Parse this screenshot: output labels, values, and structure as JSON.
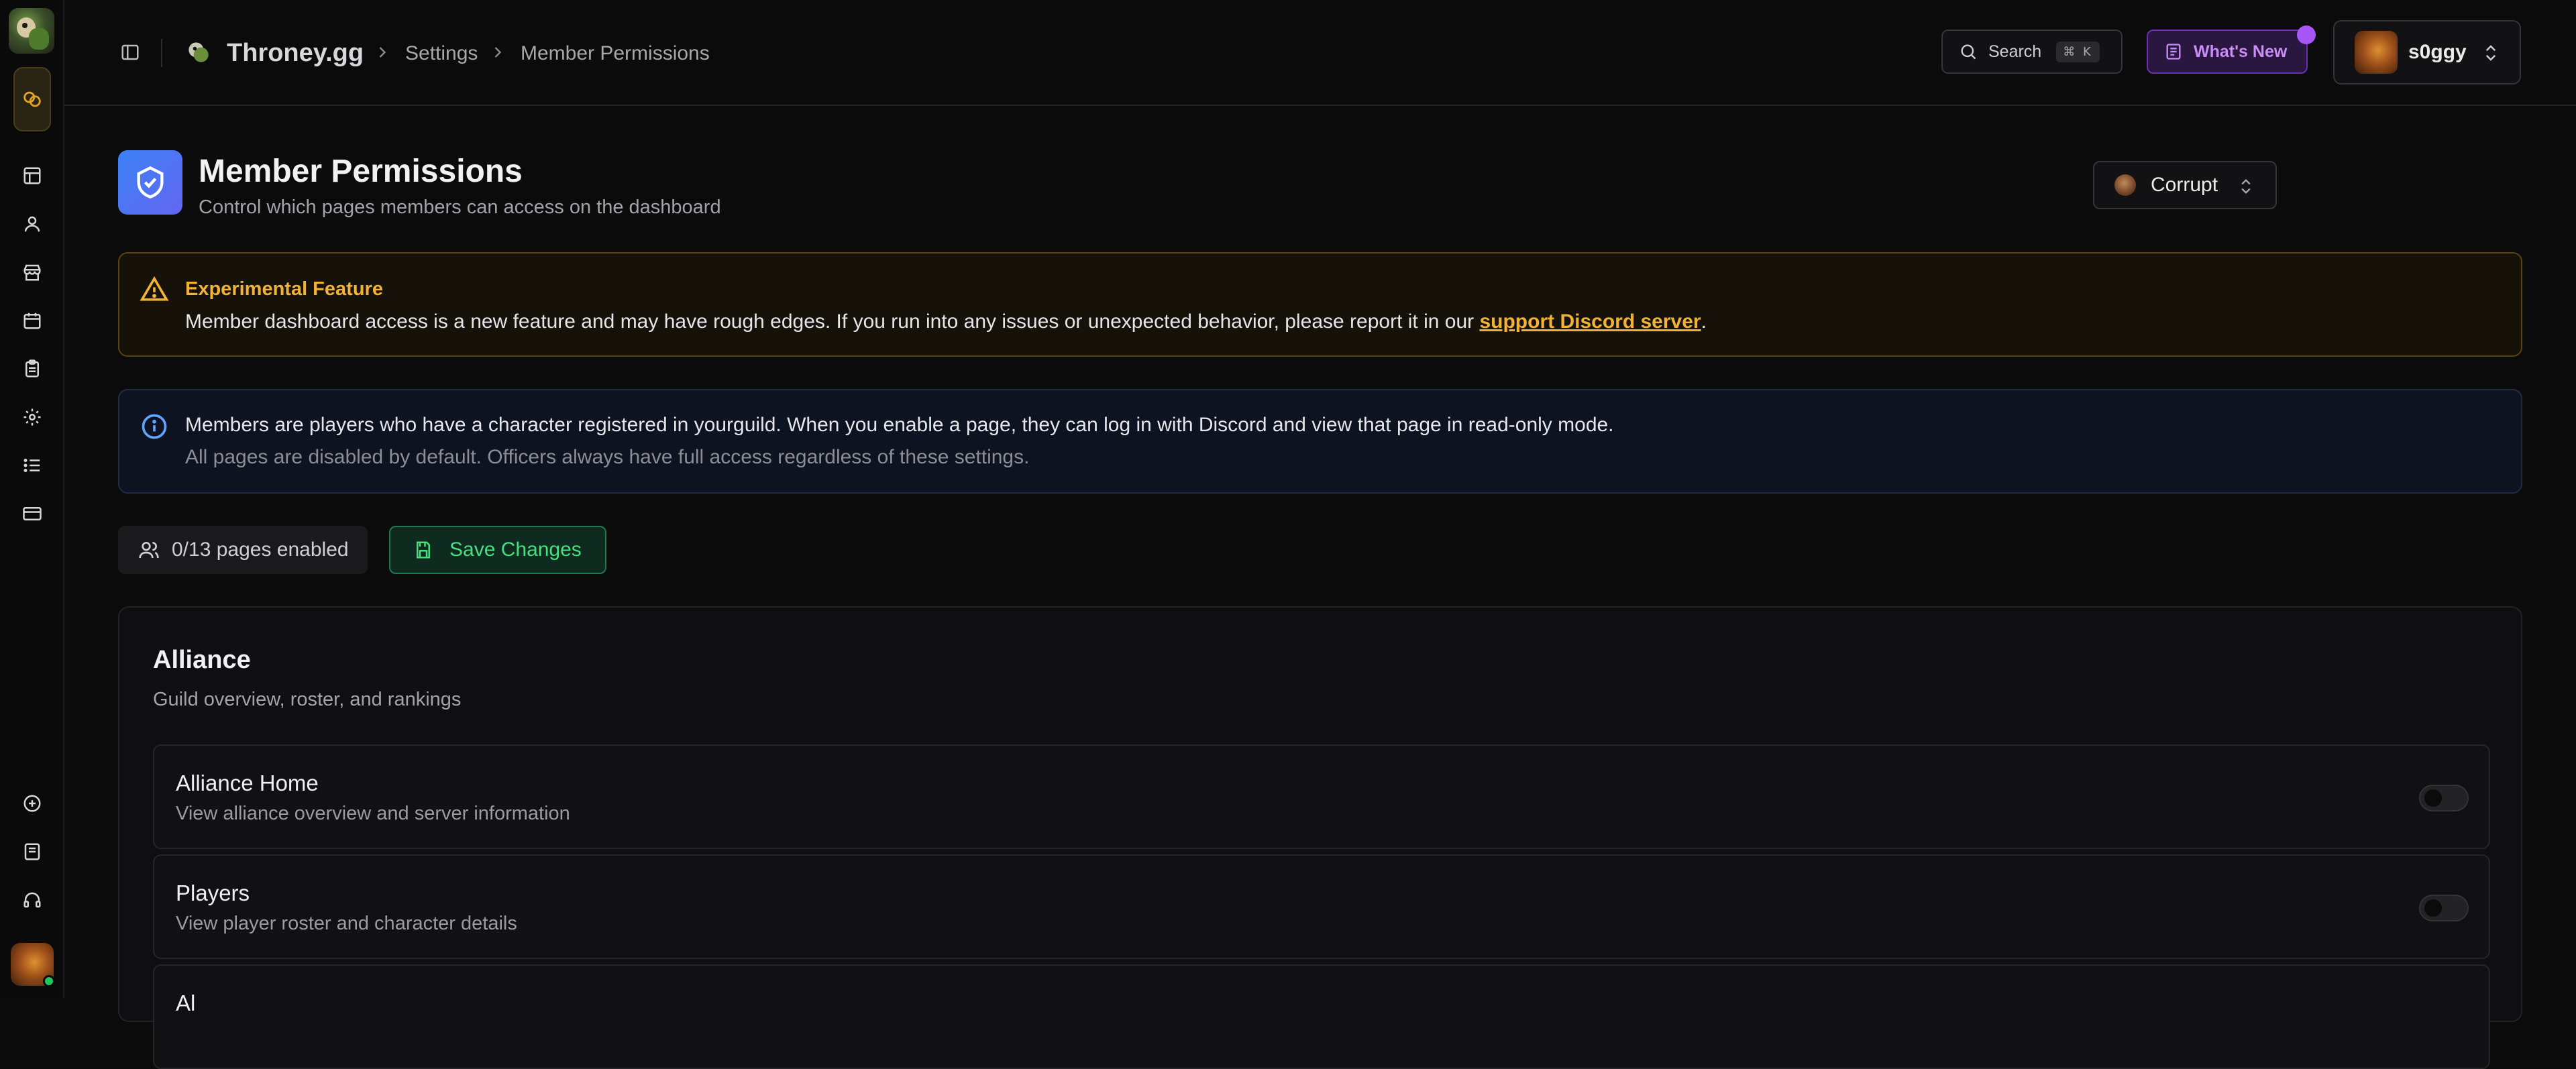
{
  "rail": {
    "logo_icon": "throney-mascot-logo",
    "guild_icon": "guild-rings-icon",
    "nav_icons": [
      "layout-icon",
      "user-icon",
      "store-icon",
      "calendar-icon",
      "clipboard-icon",
      "gear-icon",
      "list-icon",
      "card-icon"
    ],
    "bottom_icons": [
      "plus-circle-icon",
      "book-icon",
      "headset-icon"
    ],
    "status_color": "#22c55e"
  },
  "header": {
    "brand": "Throney.gg",
    "breadcrumb": [
      "Settings",
      "Member Permissions"
    ],
    "search_label": "Search",
    "search_shortcut": "⌘ K",
    "whats_new_label": "What's New",
    "username": "s0ggy"
  },
  "page": {
    "title": "Member Permissions",
    "subtitle": "Control which pages members can access on the dashboard",
    "guild_selector": "Corrupt"
  },
  "warning": {
    "title": "Experimental Feature",
    "body_prefix": "Member dashboard access is a new feature and may have rough edges. If you run into any issues or unexpected behavior, please report it in our ",
    "link": "support Discord server",
    "body_suffix": "."
  },
  "info": {
    "line1": "Members are players who have a character registered in yourguild. When you enable a page, they can log in with Discord and view that page in read-only mode.",
    "line2": "All pages are disabled by default. Officers always have full access regardless of these settings."
  },
  "toolbar": {
    "pages_enabled": "0/13 pages enabled",
    "save_label": "Save Changes"
  },
  "section": {
    "title": "Alliance",
    "subtitle": "Guild overview, roster, and rankings",
    "items": [
      {
        "title": "Alliance Home",
        "description": "View alliance overview and server information",
        "enabled": false
      },
      {
        "title": "Players",
        "description": "View player roster and character details",
        "enabled": false
      },
      {
        "title": "Al",
        "description": "",
        "enabled": false
      }
    ]
  },
  "colors": {
    "accent_warning": "#f2b233",
    "accent_info": "#60a5fa",
    "accent_save": "#4ade80",
    "accent_whats_new": "#a855f7"
  }
}
